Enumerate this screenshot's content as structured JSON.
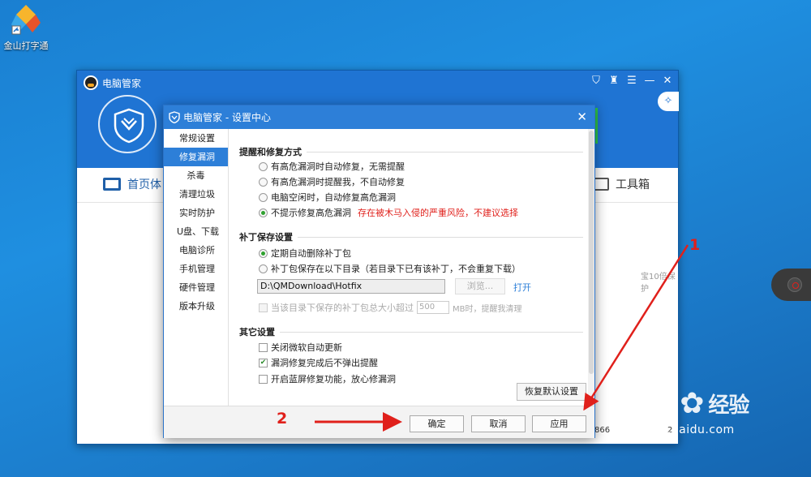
{
  "desktop": {
    "icon_label": "金山打字通"
  },
  "main_window": {
    "title": "电脑管家",
    "nav_home": "首页体",
    "nav_tools": "工具箱",
    "bg_right_text": "宝10倍保护",
    "bg_num_1": "866",
    "bg_num_2": "2"
  },
  "dialog": {
    "title": "电脑管家 - 设置中心",
    "sidebar": [
      {
        "label": "常规设置"
      },
      {
        "label": "修复漏洞"
      },
      {
        "label": "杀毒"
      },
      {
        "label": "清理垃圾"
      },
      {
        "label": "实时防护"
      },
      {
        "label": "U盘、下载"
      },
      {
        "label": "电脑诊所"
      },
      {
        "label": "手机管理"
      },
      {
        "label": "硬件管理"
      },
      {
        "label": "版本升级"
      }
    ],
    "section1": {
      "title": "提醒和修复方式",
      "options": [
        {
          "label": "有高危漏洞时自动修复，无需提醒",
          "selected": false
        },
        {
          "label": "有高危漏洞时提醒我，不自动修复",
          "selected": false
        },
        {
          "label": "电脑空闲时，自动修复高危漏洞",
          "selected": false
        },
        {
          "label": "不提示修复高危漏洞",
          "selected": true,
          "warning": "存在被木马入侵的严重风险，不建议选择"
        }
      ]
    },
    "section2": {
      "title": "补丁保存设置",
      "options": [
        {
          "label": "定期自动删除补丁包",
          "selected": true
        },
        {
          "label": "补丁包保存在以下目录（若目录下已有该补丁，不会重复下载）",
          "selected": false
        }
      ],
      "path_value": "D:\\QMDownload\\Hotfix",
      "browse_label": "浏览...",
      "open_label": "打开",
      "size_check_prefix": "当该目录下保存的补丁包总大小超过",
      "size_value": "500",
      "size_check_suffix": "MB时，提醒我清理"
    },
    "section3": {
      "title": "其它设置",
      "checks": [
        {
          "label": "关闭微软自动更新",
          "checked": false
        },
        {
          "label": "漏洞修复完成后不弹出提醒",
          "checked": true
        },
        {
          "label": "开启蓝屏修复功能，放心修漏洞",
          "checked": false
        }
      ]
    },
    "reset_label": "恢复默认设置",
    "buttons": {
      "ok": "确定",
      "cancel": "取消",
      "apply": "应用"
    }
  },
  "annotations": {
    "step1": "1",
    "step2": "2",
    "color": "#e0201b"
  },
  "watermark": {
    "logo_left": "Bai",
    "logo_right": "经验",
    "url": "jingyan.baidu.com"
  },
  "colors": {
    "accent": "#2d7fd8",
    "window_blue": "#1f74d3",
    "desktop": "#1f8fe0",
    "green": "#2ec74b"
  }
}
